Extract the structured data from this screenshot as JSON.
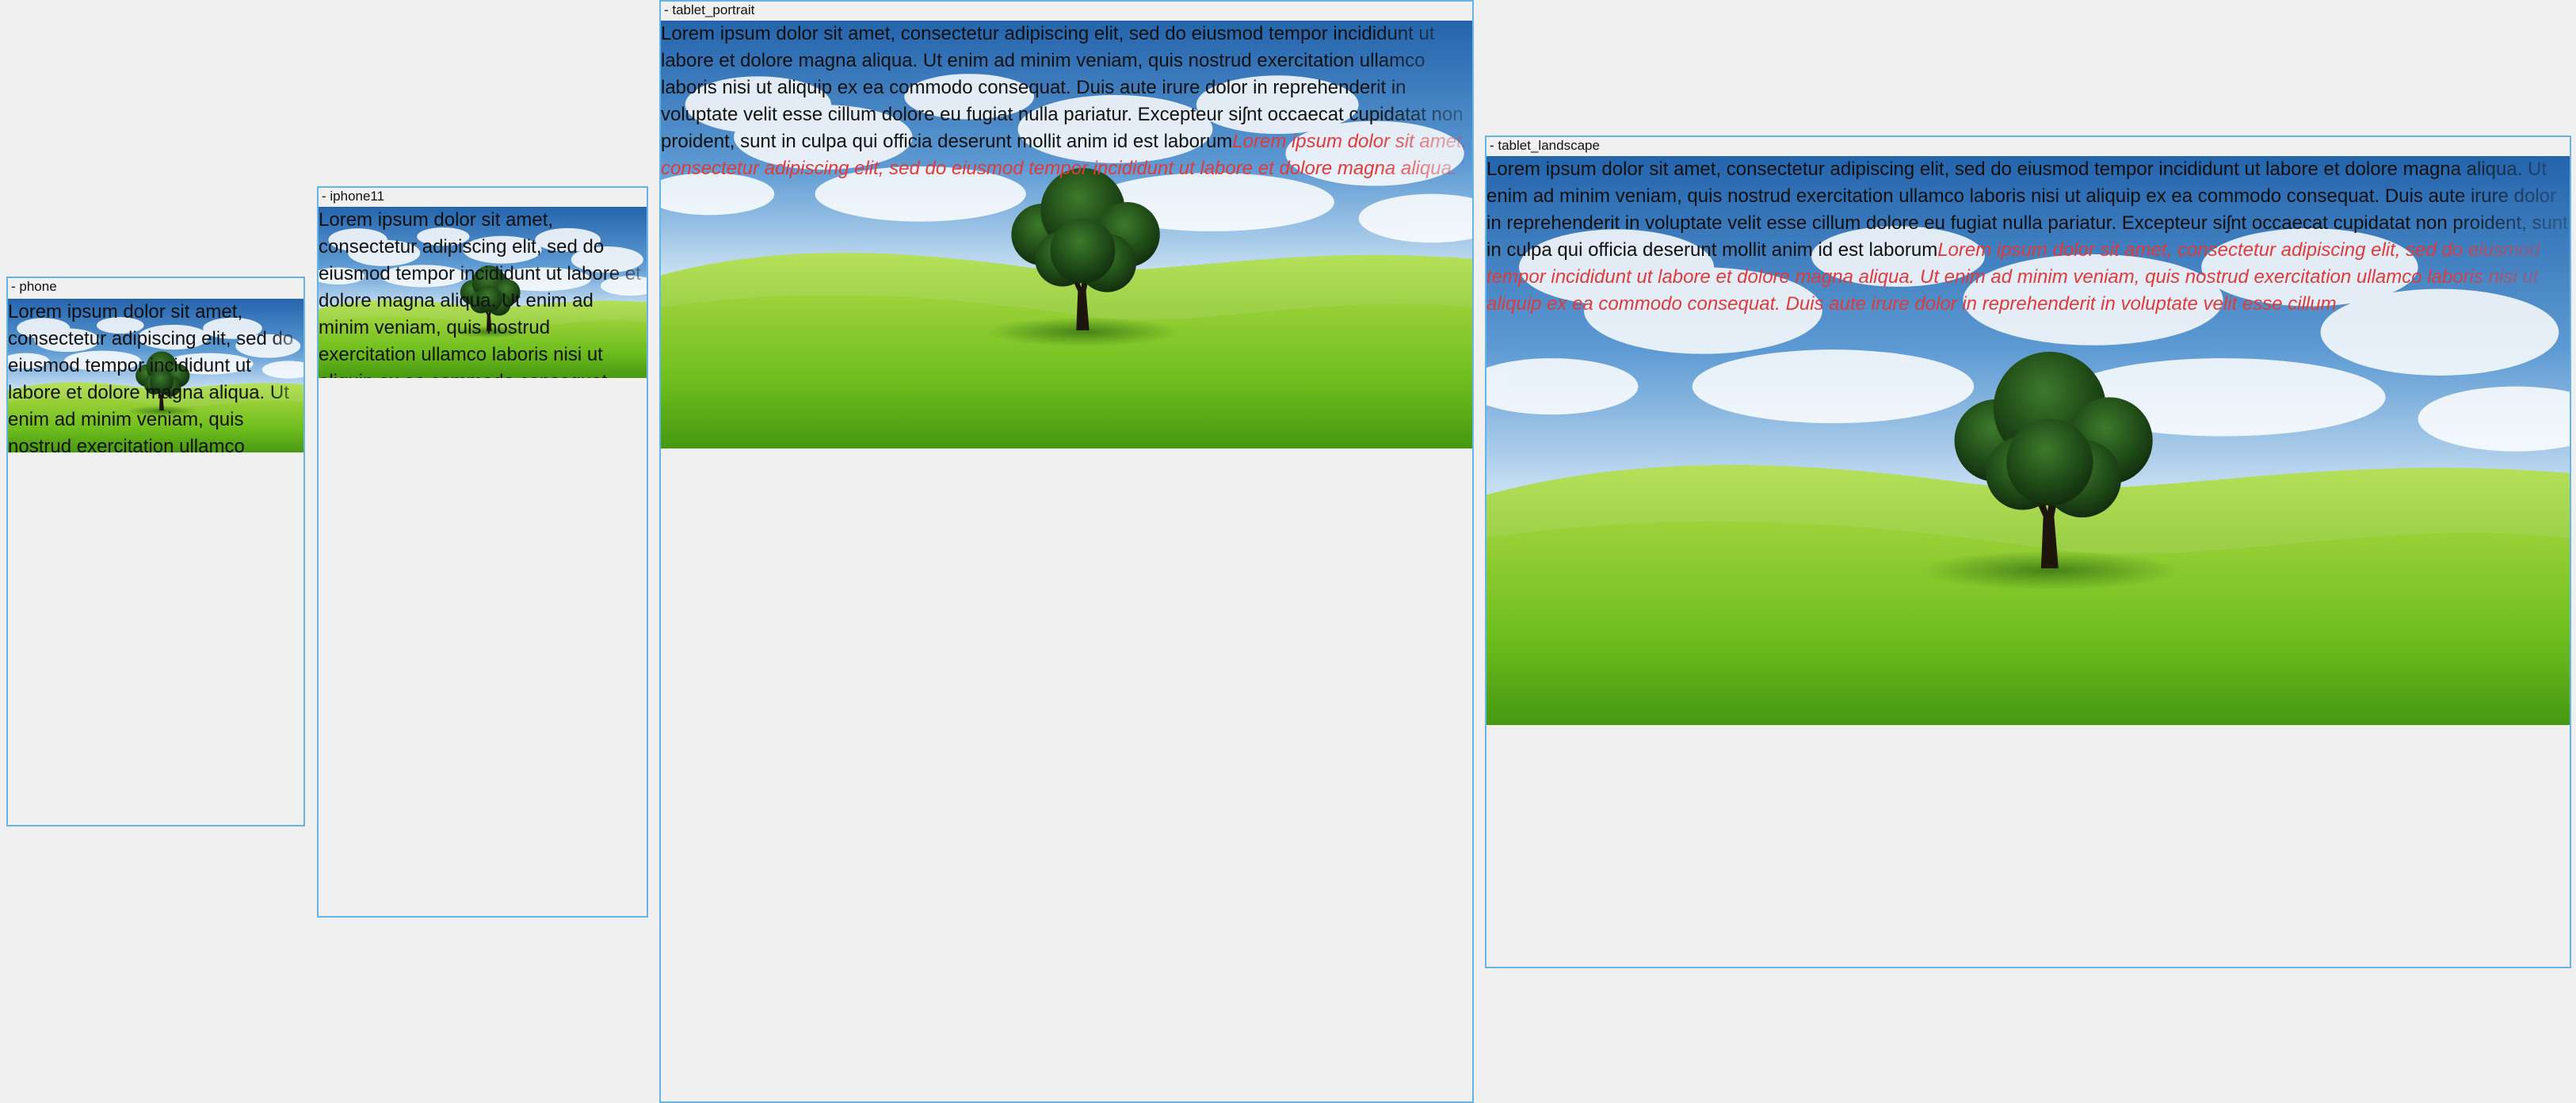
{
  "devices": {
    "phone": {
      "label": "- phone"
    },
    "iphone11": {
      "label": "- iphone11"
    },
    "tablet_portrait": {
      "label": "- tablet_portrait"
    },
    "tablet_landscape": {
      "label": "- tablet_landscape"
    }
  },
  "content": {
    "paragraph": "Lorem ipsum dolor sit amet, consectetur adipiscing elit, sed do eiusmod tempor incididunt ut labore et dolore magna aliqua. Ut enim ad minim veniam, quis nostrud exercitation ullamco laboris nisi ut aliquip ex ea commodo consequat. Duis aute irure dolor in reprehenderit in voluptate velit esse cillum dolore eu fugiat nulla pariatur. Excepteur siʃnt occaecat cupidatat non proident, sunt in culpa qui officia deserunt mollit anim id est laborum",
    "italic_paragraph": "Lorem ipsum dolor sit amet, consectetur adipiscing elit, sed do eiusmod tempor incididunt ut labore et dolore magna aliqua. Ut enim ad minim veniam, quis nostrud exercitation ullamco laboris nisi ut aliquip ex ea commodo consequat. Duis aute irure dolor in reprehenderit in voluptate velit esse cillum"
  },
  "colors": {
    "frame_border": "#64b5e6",
    "italic_text": "#e03a3a",
    "background": "#f0f0f0"
  },
  "image": {
    "subject": "tree-on-green-hills-under-blue-sky"
  }
}
